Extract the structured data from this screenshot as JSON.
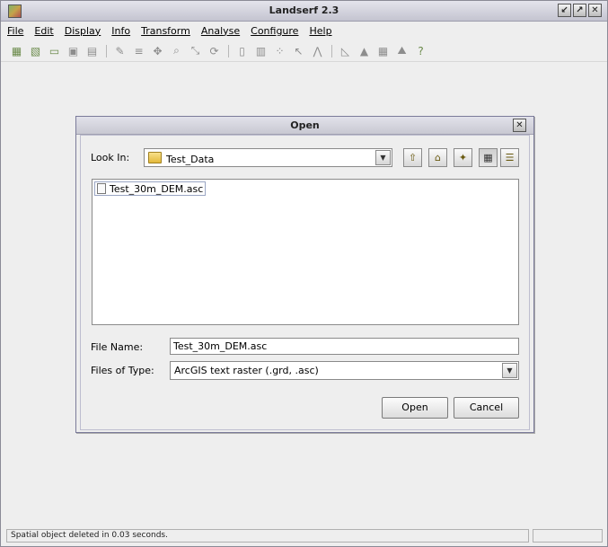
{
  "window": {
    "title": "Landserf 2.3",
    "buttons": [
      "↙",
      "↗",
      "✕"
    ]
  },
  "menu": [
    "File",
    "Edit",
    "Display",
    "Info",
    "Transform",
    "Analyse",
    "Configure",
    "Help"
  ],
  "toolbar_icons": [
    {
      "name": "raster-icon",
      "glyph": "▦",
      "color": true
    },
    {
      "name": "vector-icon",
      "glyph": "▧",
      "color": true
    },
    {
      "name": "open-icon",
      "glyph": "▭",
      "color": true
    },
    {
      "name": "save-icon",
      "glyph": "▣"
    },
    {
      "name": "print-icon",
      "glyph": "▤"
    },
    {
      "sep": true
    },
    {
      "name": "edit-icon",
      "glyph": "✎"
    },
    {
      "name": "text-icon",
      "glyph": "≡"
    },
    {
      "name": "move-icon",
      "glyph": "✥"
    },
    {
      "name": "zoom-icon",
      "glyph": "⌕"
    },
    {
      "name": "pan-icon",
      "glyph": "⤡"
    },
    {
      "name": "refresh-icon",
      "glyph": "⟳"
    },
    {
      "sep": true
    },
    {
      "name": "query-icon",
      "glyph": "▯"
    },
    {
      "name": "histogram-icon",
      "glyph": "▥"
    },
    {
      "name": "scatter-icon",
      "glyph": "⁘"
    },
    {
      "name": "pointer-query-icon",
      "glyph": "↖"
    },
    {
      "name": "profile-icon",
      "glyph": "⋀"
    },
    {
      "sep": true
    },
    {
      "name": "slope-icon",
      "glyph": "◺"
    },
    {
      "name": "features-icon",
      "glyph": "▲"
    },
    {
      "name": "grid-icon",
      "glyph": "▦"
    },
    {
      "name": "relief-icon",
      "glyph": "⛰"
    },
    {
      "name": "help-icon",
      "glyph": "?",
      "color": true
    }
  ],
  "dialog": {
    "title": "Open",
    "look_in_label": "Look In:",
    "look_in_value": "Test_Data",
    "files": [
      "Test_30m_DEM.asc"
    ],
    "file_name_label": "File Name:",
    "file_name_value": "Test_30m_DEM.asc",
    "files_of_type_label": "Files of Type:",
    "files_of_type_value": "ArcGIS text raster (.grd, .asc)",
    "open_button": "Open",
    "cancel_button": "Cancel"
  },
  "status": {
    "message": "Spatial object deleted in 0.03 seconds."
  }
}
